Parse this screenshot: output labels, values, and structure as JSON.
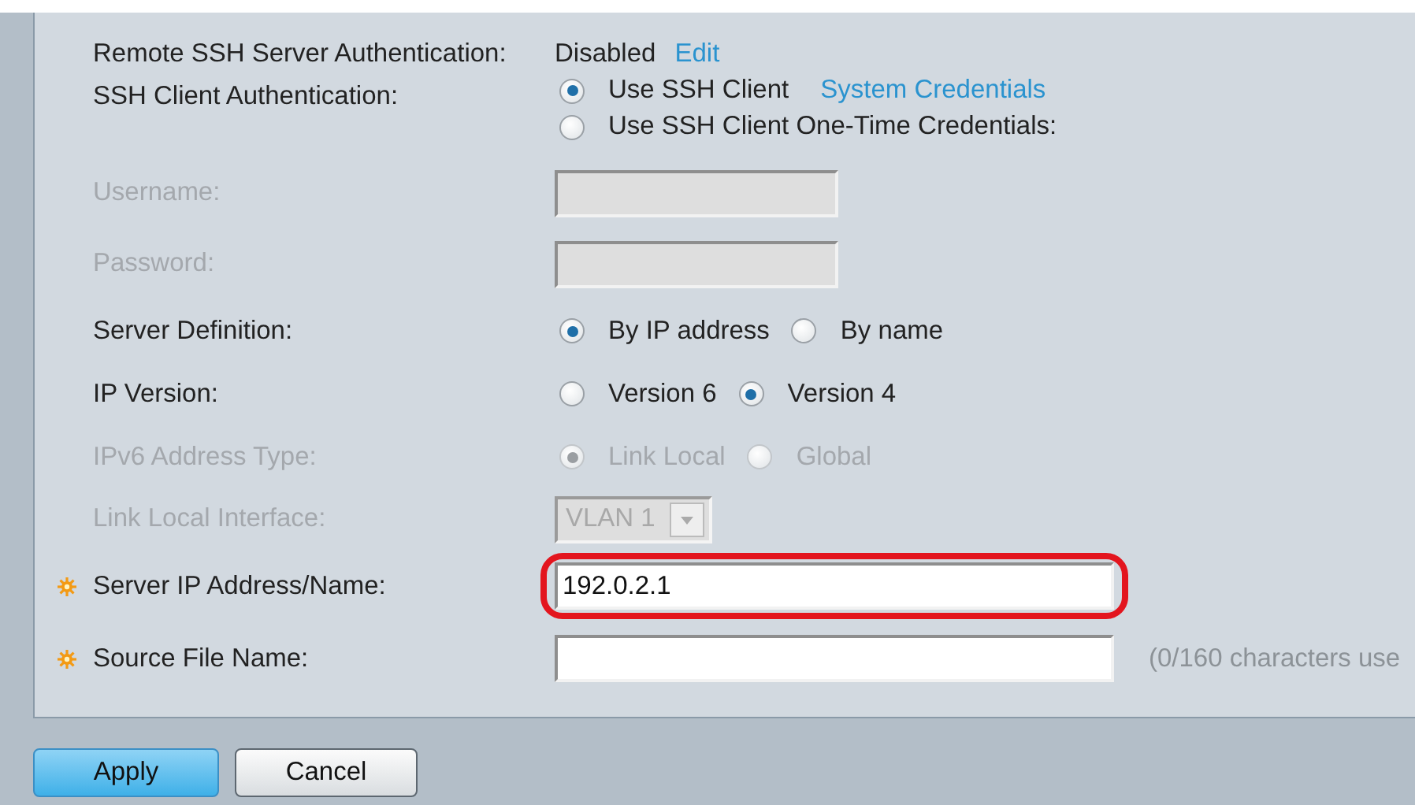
{
  "rows": [
    {
      "kind": "text",
      "label": "Remote SSH Server Authentication:",
      "disabled": false,
      "required": false,
      "value": "Disabled",
      "link": "Edit"
    },
    {
      "kind": "stack",
      "label": "SSH Client Authentication:",
      "disabled": false,
      "required": false,
      "options": [
        {
          "text": "Use SSH Client ",
          "link": "System Credentials",
          "selected": true
        },
        {
          "text": "Use SSH Client One-Time Credentials:",
          "selected": false
        }
      ]
    },
    {
      "kind": "field",
      "label": "Username:",
      "disabled": true,
      "required": false,
      "value": ""
    },
    {
      "kind": "field",
      "label": "Password:",
      "disabled": true,
      "required": false,
      "value": ""
    },
    {
      "kind": "radios",
      "label": "Server Definition:",
      "disabled": false,
      "required": false,
      "options": [
        {
          "text": "By IP address",
          "selected": true
        },
        {
          "text": "By name",
          "selected": false
        }
      ]
    },
    {
      "kind": "radios",
      "label": "IP Version:",
      "disabled": false,
      "required": false,
      "options": [
        {
          "text": "Version 6",
          "selected": false
        },
        {
          "text": "Version 4",
          "selected": true
        }
      ]
    },
    {
      "kind": "radios",
      "label": "IPv6 Address Type:",
      "disabled": true,
      "required": false,
      "options": [
        {
          "text": "Link Local",
          "selected": true
        },
        {
          "text": "Global",
          "selected": false
        }
      ]
    },
    {
      "kind": "select",
      "label": "Link Local Interface:",
      "disabled": true,
      "required": false,
      "value": "VLAN 1"
    },
    {
      "kind": "input",
      "label": "Server IP Address/Name:",
      "disabled": false,
      "required": true,
      "value": "192.0.2.1",
      "highlighted": true
    },
    {
      "kind": "input",
      "label": "Source File Name:",
      "disabled": false,
      "required": true,
      "value": "",
      "hint": "(0/160 characters use"
    }
  ],
  "buttons": [
    {
      "label": "Apply",
      "primary": true
    },
    {
      "label": "Cancel",
      "primary": false
    }
  ]
}
